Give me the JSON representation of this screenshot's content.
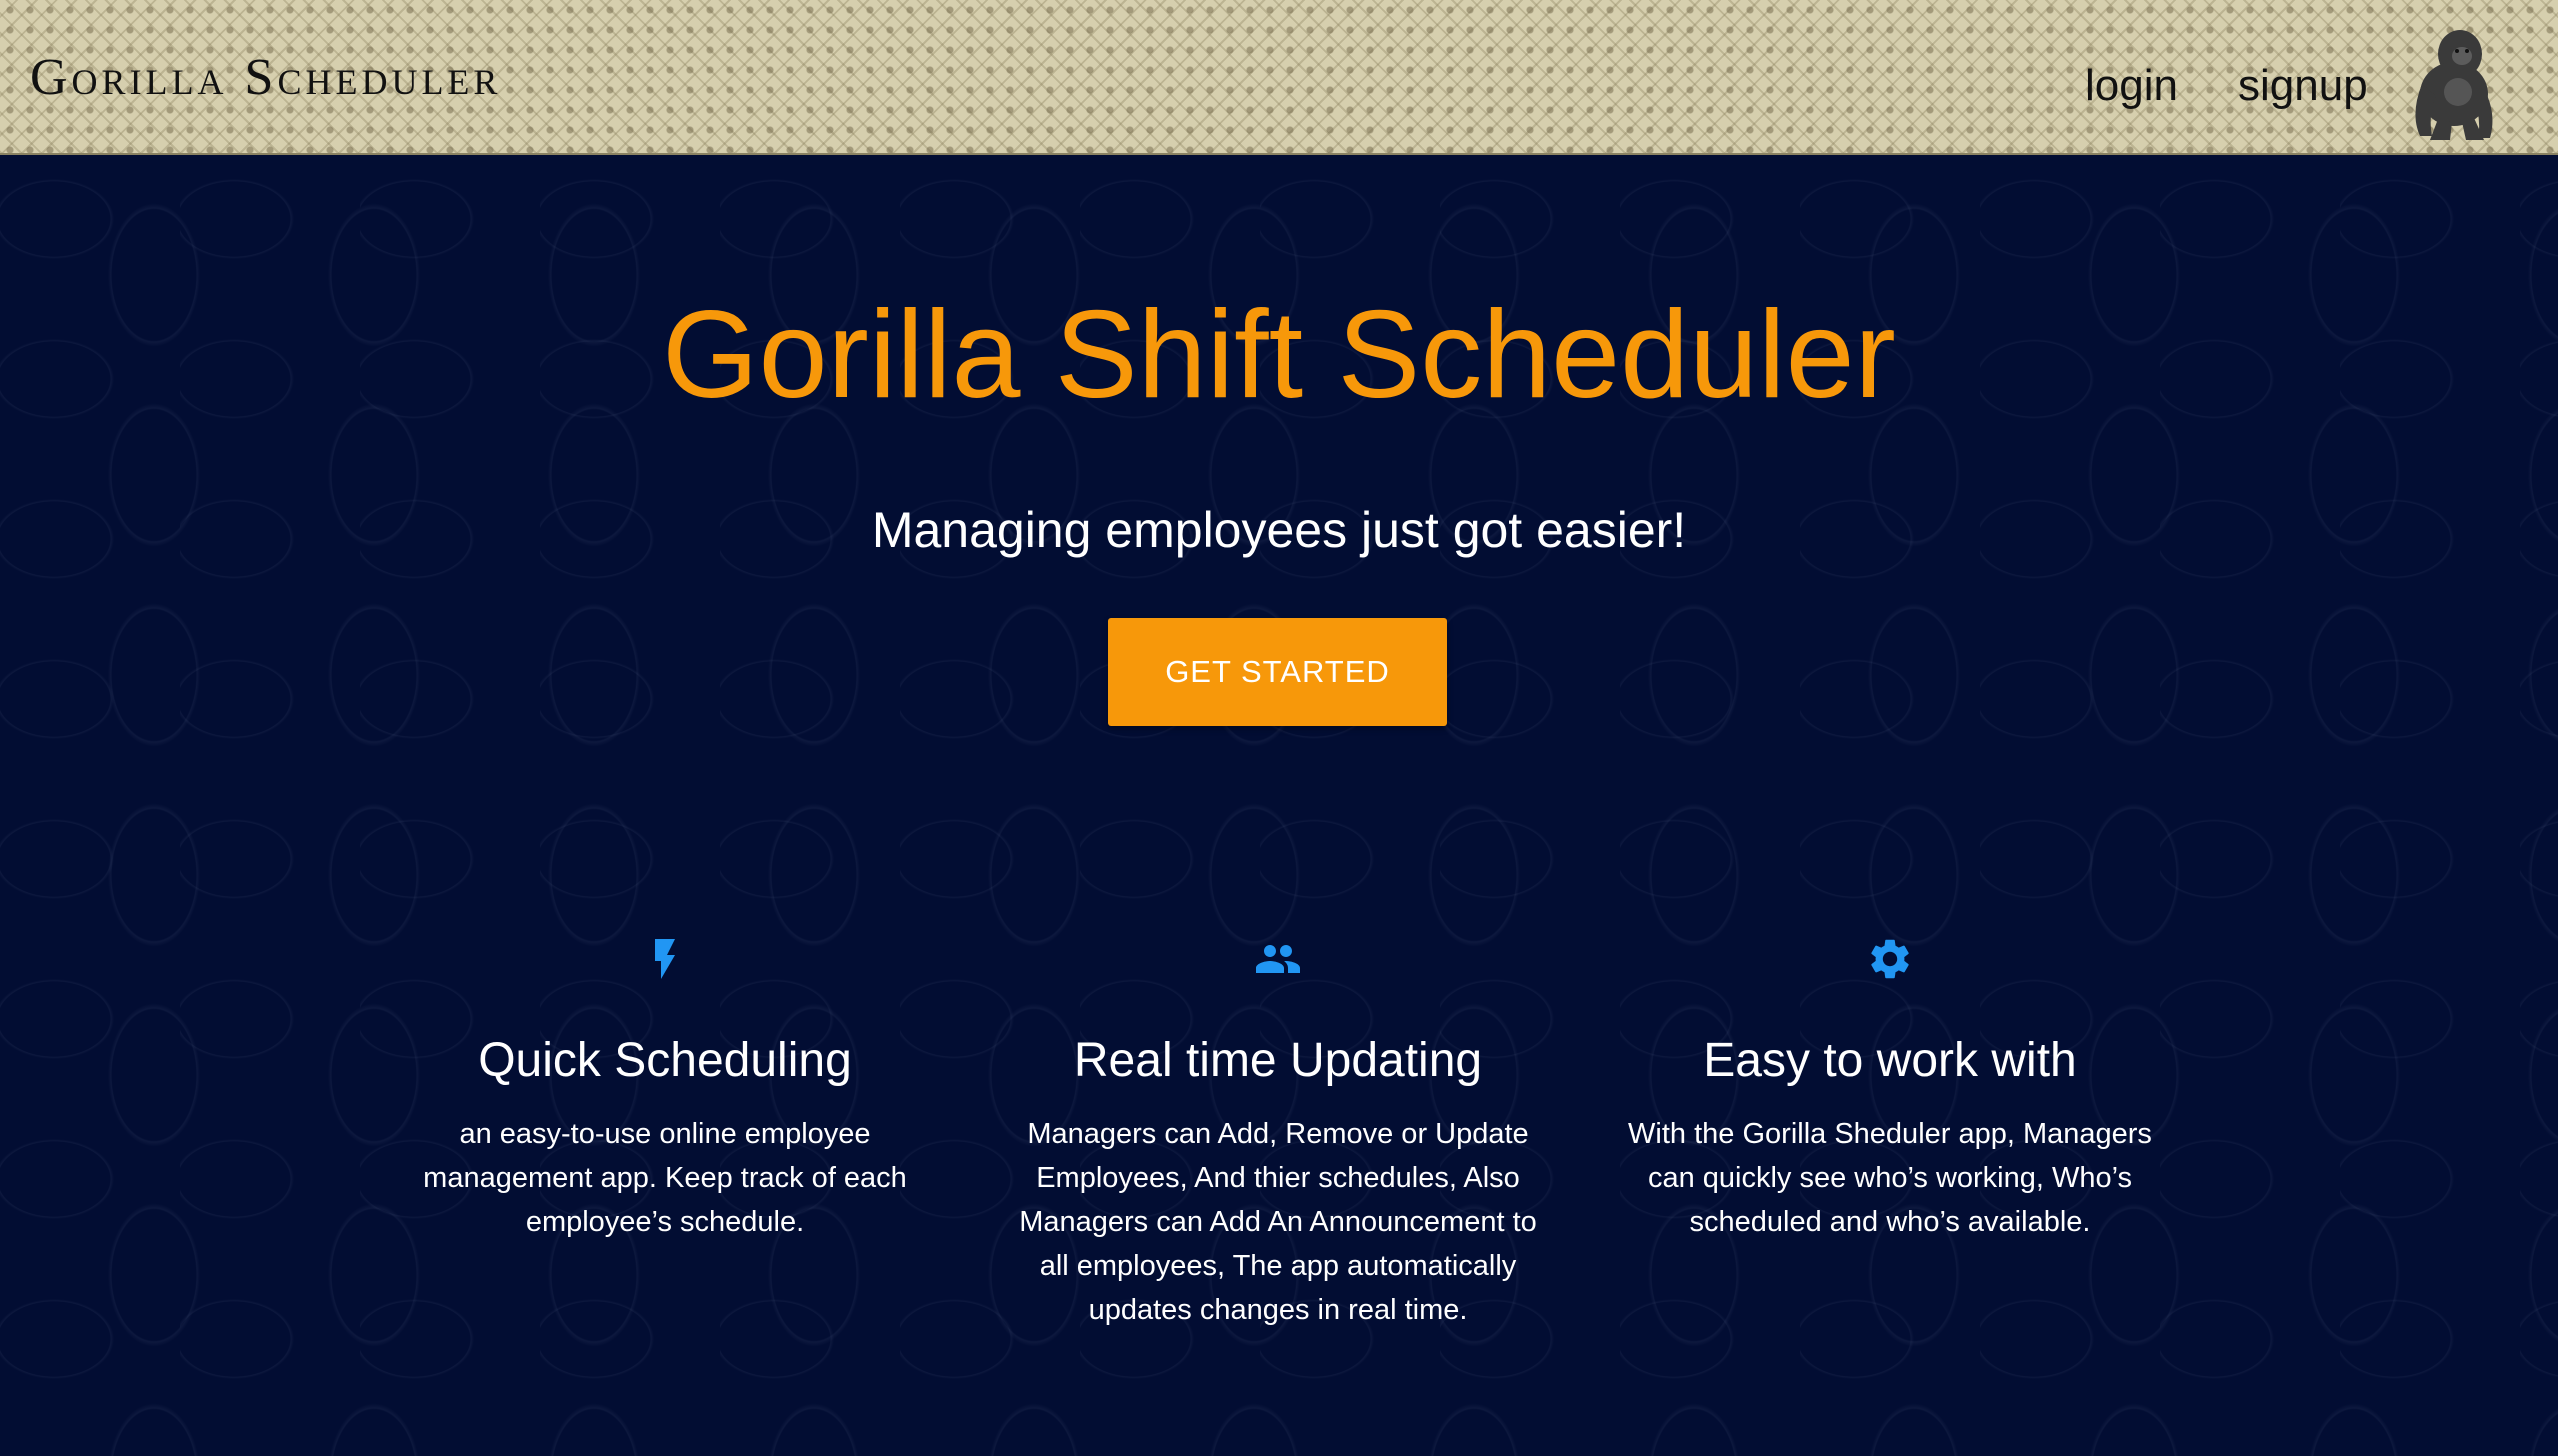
{
  "header": {
    "brand": "Gorilla Scheduler",
    "nav": {
      "login": "login",
      "signup": "signup"
    },
    "logo_icon": "gorilla-icon"
  },
  "hero": {
    "title": "Gorilla Shift Scheduler",
    "subtitle": "Managing employees just got easier!",
    "cta_label": "GET STARTED"
  },
  "features": [
    {
      "icon": "flash-icon",
      "title": "Quick Scheduling",
      "description": "an easy-to-use online employee management app. Keep track of each employee’s schedule."
    },
    {
      "icon": "people-icon",
      "title": "Real time Updating",
      "description": "Managers can Add, Remove or Update Employees, And thier schedules, Also Managers can Add An Announcement to all employees, The app automatically updates changes in real time."
    },
    {
      "icon": "gear-icon",
      "title": "Easy to work with",
      "description": "With the Gorilla Sheduler app, Managers can quickly see who’s working, Who’s scheduled and who’s available."
    }
  ],
  "colors": {
    "accent": "#f7980a",
    "background": "#020d33",
    "icon": "#2196f3",
    "header_bg": "#d6cfae"
  }
}
